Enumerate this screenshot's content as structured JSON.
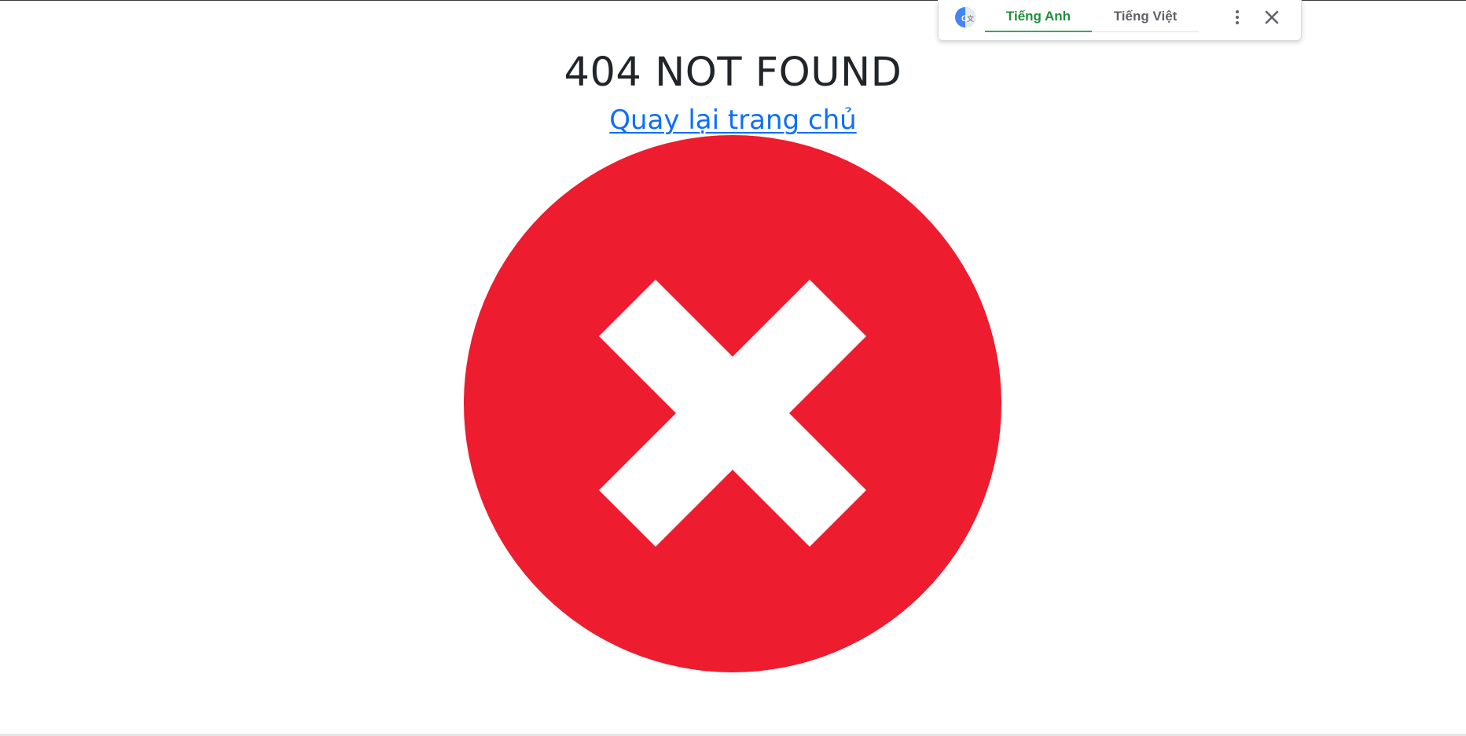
{
  "page": {
    "title": "404 NOT FOUND",
    "home_link_text": "Quay lại trang chủ"
  },
  "error_graphic": {
    "icon": "error-x-circle-icon",
    "circle_color": "#ed1c2e",
    "cross_color": "#ffffff"
  },
  "translate_bar": {
    "logo_icon": "google-translate-icon",
    "tabs": [
      {
        "label": "Tiếng Anh",
        "active": true
      },
      {
        "label": "Tiếng Việt",
        "active": false
      }
    ],
    "more_icon": "more-vert-icon",
    "close_icon": "close-icon",
    "active_color": "#1e8e3e"
  },
  "colors": {
    "title": "#212529",
    "link": "#0d6efd"
  }
}
